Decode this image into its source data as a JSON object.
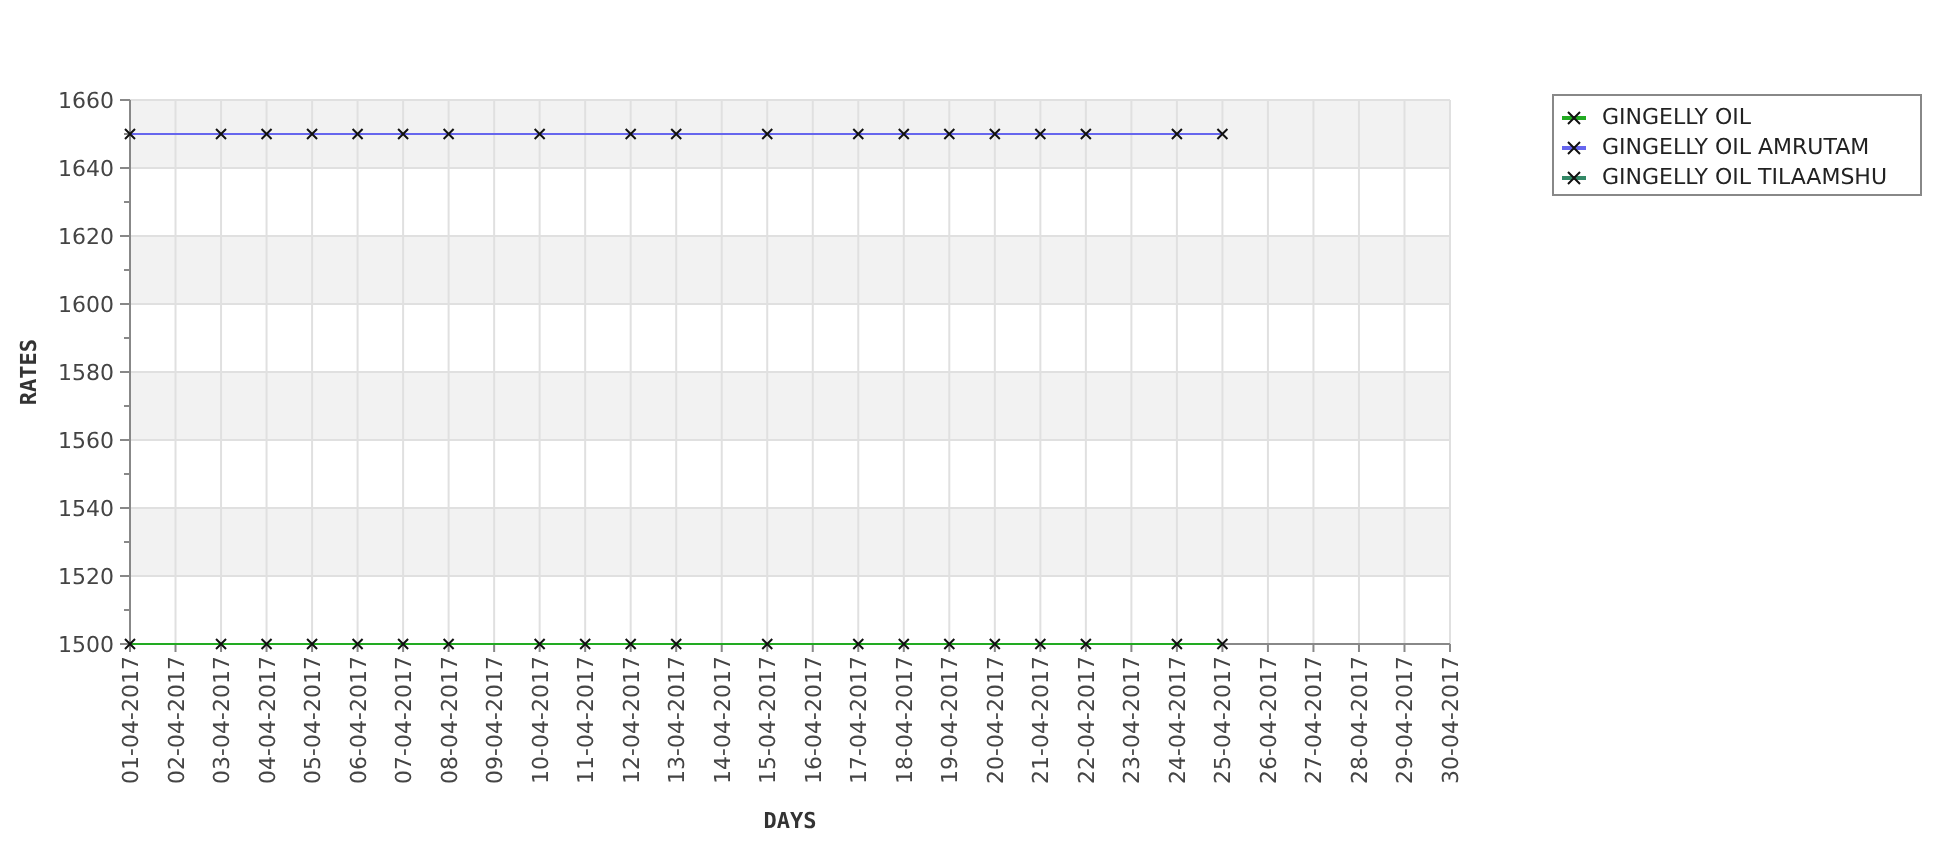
{
  "chart_data": {
    "type": "line",
    "xlabel": "DAYS",
    "ylabel": "RATES",
    "categories": [
      "01-04-2017",
      "02-04-2017",
      "03-04-2017",
      "04-04-2017",
      "05-04-2017",
      "06-04-2017",
      "07-04-2017",
      "08-04-2017",
      "09-04-2017",
      "10-04-2017",
      "11-04-2017",
      "12-04-2017",
      "13-04-2017",
      "14-04-2017",
      "15-04-2017",
      "16-04-2017",
      "17-04-2017",
      "18-04-2017",
      "19-04-2017",
      "20-04-2017",
      "21-04-2017",
      "22-04-2017",
      "23-04-2017",
      "24-04-2017",
      "25-04-2017",
      "26-04-2017",
      "27-04-2017",
      "28-04-2017",
      "29-04-2017",
      "30-04-2017"
    ],
    "ylim": [
      1500,
      1660
    ],
    "grid": true,
    "yticks": [
      1500,
      1520,
      1540,
      1560,
      1580,
      1600,
      1620,
      1640,
      1660
    ],
    "series": [
      {
        "name": "GINGELLY OIL",
        "color": "#22aa22",
        "marker": "x",
        "values": [
          1500,
          null,
          1500,
          1500,
          1500,
          1500,
          1500,
          1500,
          null,
          1500,
          1500,
          1500,
          1500,
          null,
          1500,
          null,
          1500,
          1500,
          1500,
          1500,
          1500,
          1500,
          null,
          1500,
          1500,
          null,
          null,
          null,
          null,
          null
        ]
      },
      {
        "name": "GINGELLY OIL AMRUTAM",
        "color": "#6666ee",
        "marker": "x",
        "values": [
          1650,
          null,
          1650,
          1650,
          1650,
          1650,
          1650,
          1650,
          null,
          1650,
          null,
          1650,
          1650,
          null,
          1650,
          null,
          1650,
          1650,
          1650,
          1650,
          1650,
          1650,
          null,
          1650,
          1650,
          null,
          null,
          null,
          null,
          null
        ]
      },
      {
        "name": "GINGELLY OIL TILAAMSHU",
        "color": "#338866",
        "marker": "x",
        "values": [
          null,
          null,
          null,
          null,
          null,
          null,
          null,
          null,
          null,
          null,
          null,
          null,
          null,
          null,
          null,
          null,
          null,
          null,
          null,
          null,
          null,
          null,
          null,
          null,
          null,
          null,
          null,
          null,
          null,
          null
        ]
      }
    ]
  }
}
